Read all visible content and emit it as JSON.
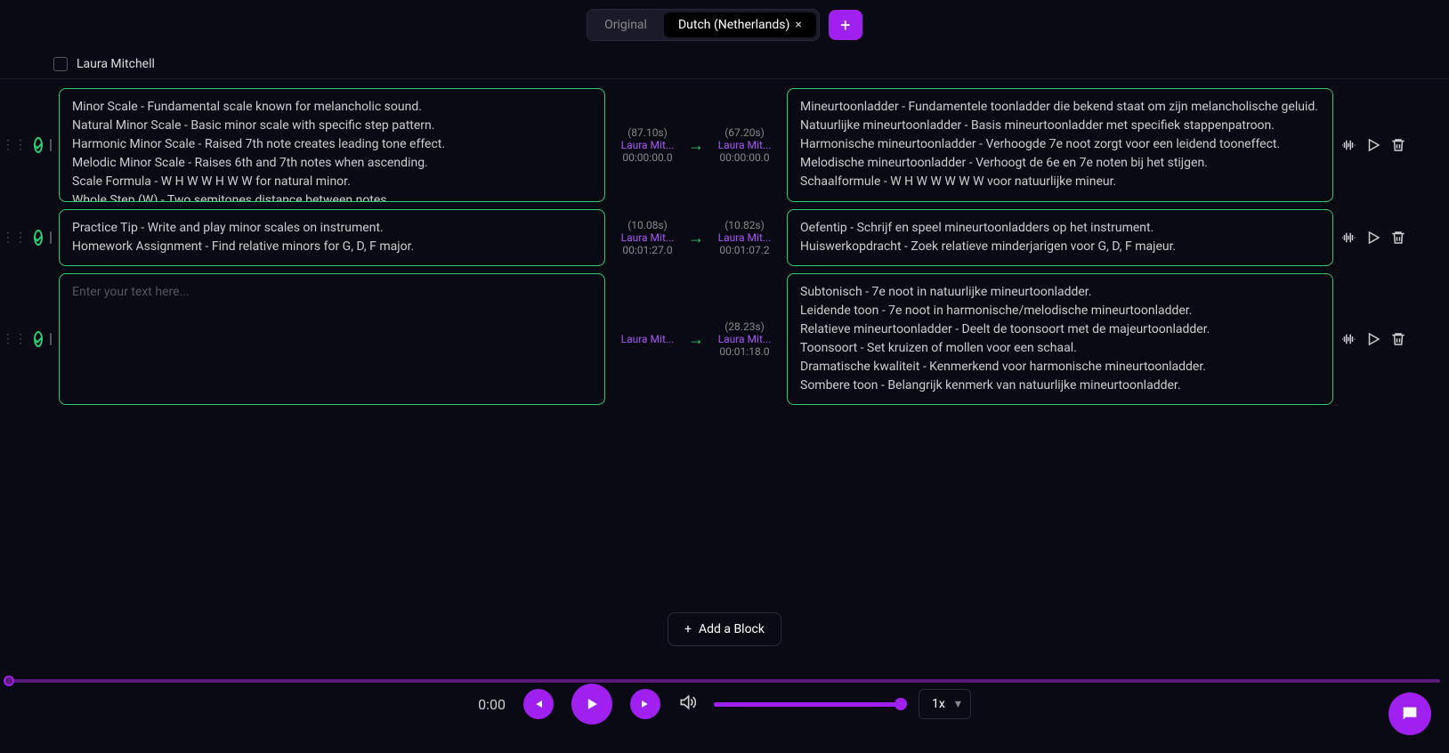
{
  "tabs": {
    "original": "Original",
    "target": "Dutch (Netherlands)"
  },
  "speaker": "Laura Mitchell",
  "blocks": [
    {
      "left_text": "Minor Scale - Fundamental scale known for melancholic sound.\nNatural Minor Scale - Basic minor scale with specific step pattern.\nHarmonic Minor Scale - Raised 7th note creates leading tone effect.\nMelodic Minor Scale - Raises 6th and 7th notes when ascending.\nScale Formula - W H W W H W W for natural minor.\nWhole Step (W) - Two semitones distance between notes.",
      "right_text": "Mineurtoonladder - Fundamentele toonladder die bekend staat om zijn melancholische geluid.\nNatuurlijke mineurtoonladder - Basis mineurtoonladder met specifiek stappenpatroon.\nHarmonische mineurtoonladder - Verhoogde 7e noot zorgt voor een leidend tooneffect.\nMelodische mineurtoonladder - Verhoogt de 6e en 7e noten bij het stijgen.\nSchaalformule - W H W W W W W voor natuurlijke mineur.",
      "src": {
        "duration": "(87.10s)",
        "speaker": "Laura Mit...",
        "ts": "00:00:00.0"
      },
      "dst": {
        "duration": "(67.20s)",
        "speaker": "Laura Mit...",
        "ts": "00:00:00.0"
      }
    },
    {
      "left_text": "Practice Tip - Write and play minor scales on instrument.\nHomework Assignment - Find relative minors for G, D, F major.",
      "right_text": "Oefentip - Schrijf en speel mineurtoonladders op het instrument.\nHuiswerkopdracht - Zoek relatieve minderjarigen voor G, D, F majeur.",
      "src": {
        "duration": "(10.08s)",
        "speaker": "Laura Mit...",
        "ts": "00:01:27.0"
      },
      "dst": {
        "duration": "(10.82s)",
        "speaker": "Laura Mit...",
        "ts": "00:01:07.2"
      }
    },
    {
      "left_placeholder": "Enter your text here...",
      "right_text": "Subtonisch - 7e noot in natuurlijke mineurtoonladder.\nLeidende toon - 7e noot in harmonische/melodische mineurtoonladder.\nRelatieve mineurtoonladder - Deelt de toonsoort met de majeurtoonladder.\nToonsoort - Set kruizen of mollen voor een schaal.\nDramatische kwaliteit - Kenmerkend voor harmonische mineurtoonladder.\nSombere toon - Belangrijk kenmerk van natuurlijke mineurtoonladder.",
      "dst": {
        "duration": "(28.23s)",
        "speaker": "Laura Mit...",
        "ts": "00:01:18.0"
      },
      "src": {
        "speaker": "Laura Mit..."
      }
    }
  ],
  "add_block_label": "Add a Block",
  "player": {
    "time": "0:00",
    "speed": "1x"
  }
}
